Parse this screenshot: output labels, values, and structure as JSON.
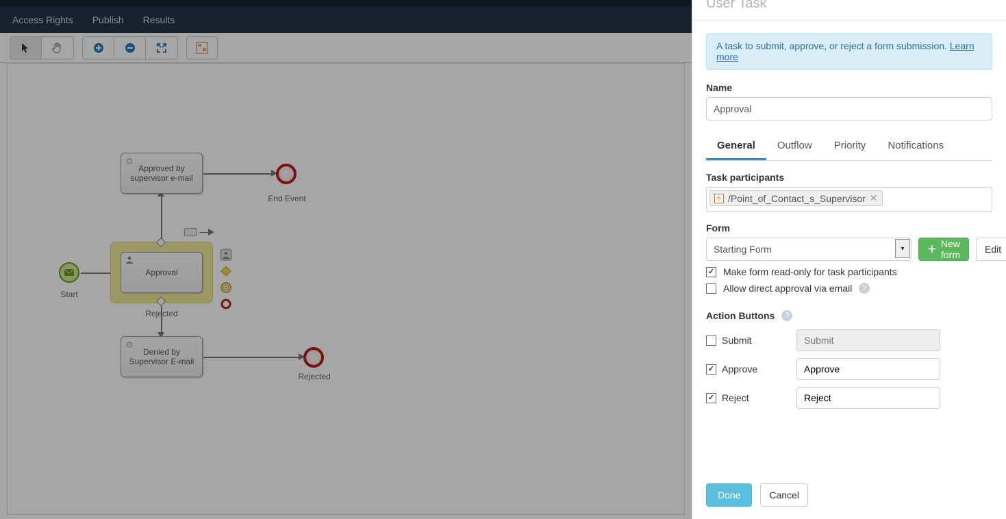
{
  "nav": {
    "items": [
      "Access Rights",
      "Publish",
      "Results"
    ]
  },
  "toolbar": {
    "pointer": "pointer",
    "pan": "pan",
    "zoom_in": "zoom-in",
    "zoom_out": "zoom-out",
    "fit": "fit",
    "overview": "overview"
  },
  "canvas": {
    "start_label": "Start",
    "approval": "Approval",
    "approved_box": "Approved by supervisor e-mail",
    "denied_box": "Denied by Supervisor E-mail",
    "end_event_label": "End Event",
    "rejected_label_top": "Rejected",
    "rejected_label_bottom": "Rejected"
  },
  "panel": {
    "title": "User Task",
    "info_text": "A task to submit, approve, or reject a form submission. ",
    "info_link": "Learn more",
    "name_label": "Name",
    "name_value": "Approval",
    "tabs": [
      "General",
      "Outflow",
      "Priority",
      "Notifications"
    ],
    "participants_label": "Task participants",
    "participant_token": "/Point_of_Contact_s_Supervisor",
    "form_label": "Form",
    "form_value": "Starting Form",
    "new_form_btn": "New form",
    "edit_btn": "Edit",
    "readonly_label": "Make form read-only for task participants",
    "direct_label": "Allow direct approval via email",
    "action_buttons_label": "Action Buttons",
    "actions": {
      "submit": {
        "label": "Submit",
        "value": "Submit",
        "checked": false,
        "disabled": true
      },
      "approve": {
        "label": "Approve",
        "value": "Approve",
        "checked": true,
        "disabled": false
      },
      "reject": {
        "label": "Reject",
        "value": "Reject",
        "checked": true,
        "disabled": false
      }
    },
    "done": "Done",
    "cancel": "Cancel"
  }
}
